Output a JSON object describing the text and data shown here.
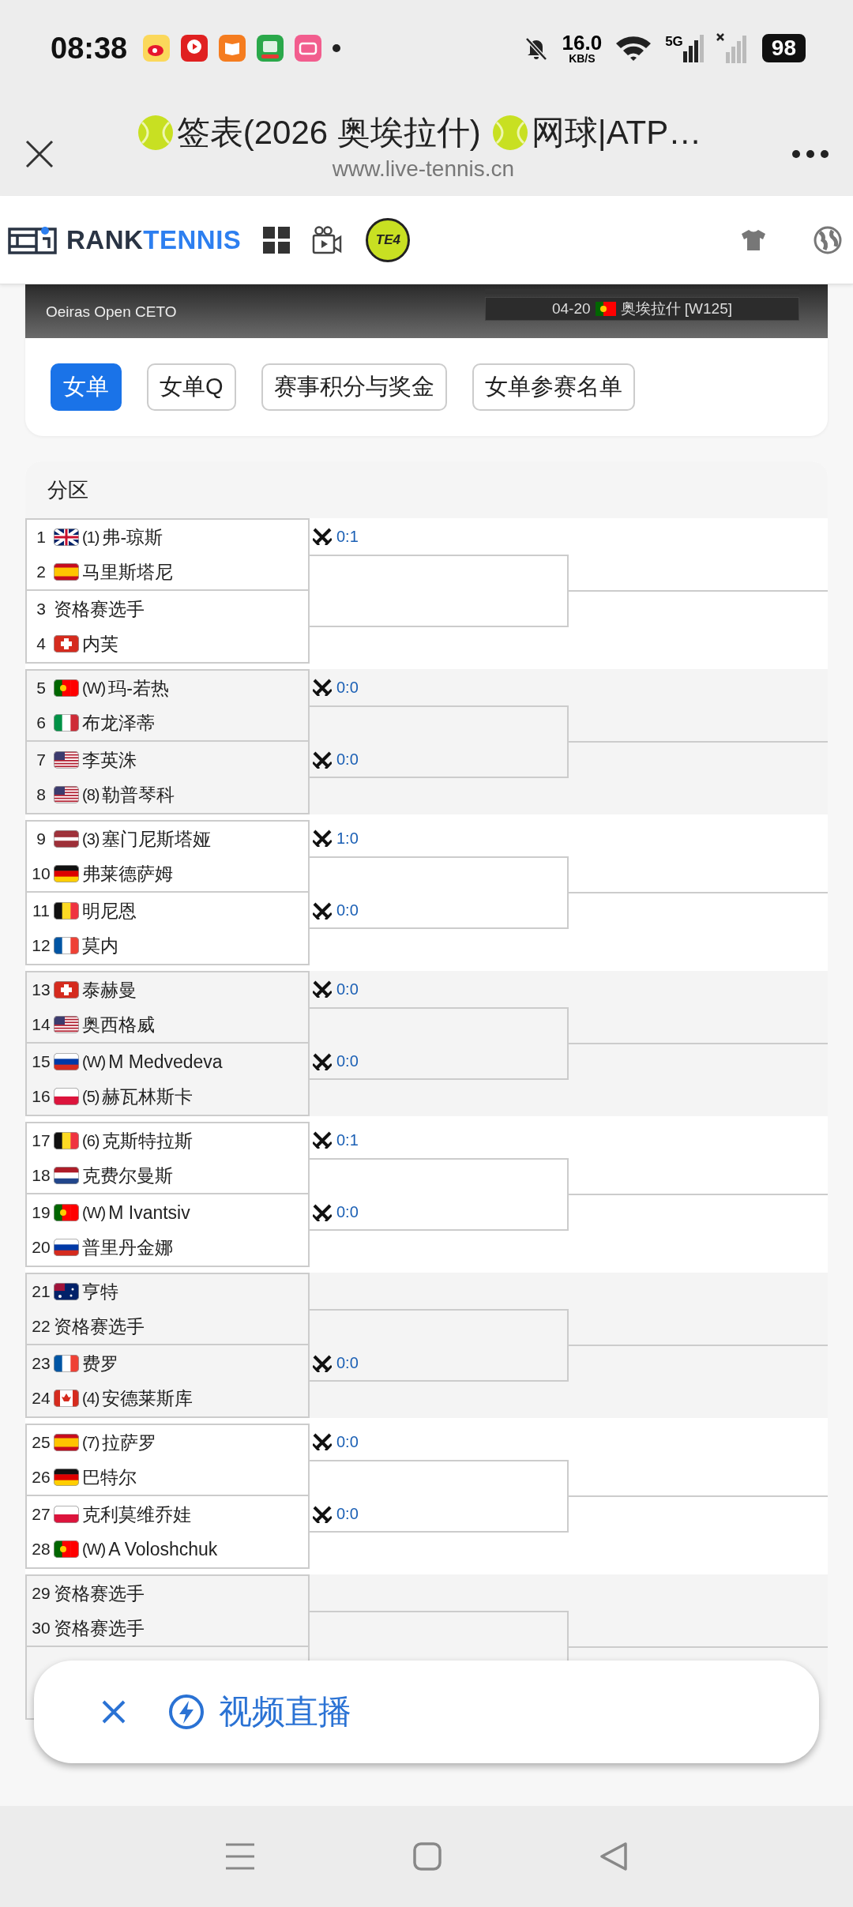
{
  "status_bar": {
    "time": "08:38",
    "speed_value": "16.0",
    "speed_unit": "KB/S",
    "network": "5G",
    "battery": "98"
  },
  "browser": {
    "title_parts": [
      "签表(2026 奥埃拉什)",
      "网球|ATP…"
    ],
    "url": "www.live-tennis.cn"
  },
  "site_header": {
    "logo_lead": "RANK",
    "logo_tail": "TENNIS",
    "badge": "TE4"
  },
  "banner": {
    "tournament": "Oeiras Open CETO",
    "date": "04-20",
    "location": "奥埃拉什 [W125]"
  },
  "tabs": [
    {
      "label": "女单",
      "selected": true
    },
    {
      "label": "女单Q",
      "selected": false
    },
    {
      "label": "赛事积分与奖金",
      "selected": false
    },
    {
      "label": "女单参赛名单",
      "selected": false
    }
  ],
  "draw": {
    "section_title": "分区",
    "groups": [
      {
        "matches": [
          {
            "score": "0:1",
            "players": [
              {
                "number": "1",
                "flag": {
                  "kind": "gb"
                },
                "seed": "(1)",
                "name": "弗-琼斯"
              },
              {
                "number": "2",
                "flag": {
                  "kind": "es"
                },
                "name": "马里斯塔尼"
              }
            ]
          },
          {
            "players": [
              {
                "number": "3",
                "name": "资格赛选手"
              },
              {
                "number": "4",
                "flag": {
                  "kind": "ch"
                },
                "name": "内芙"
              }
            ]
          }
        ]
      },
      {
        "matches": [
          {
            "score": "0:0",
            "players": [
              {
                "number": "5",
                "flag": {
                  "kind": "pt"
                },
                "seed": "(W)",
                "name": "玛-若热"
              },
              {
                "number": "6",
                "flag": {
                  "kind": "it"
                },
                "name": "布龙泽蒂"
              }
            ]
          },
          {
            "score": "0:0",
            "players": [
              {
                "number": "7",
                "flag": {
                  "kind": "us"
                },
                "name": "李英洙"
              },
              {
                "number": "8",
                "flag": {
                  "kind": "us"
                },
                "seed": "(8)",
                "name": "勒普琴科"
              }
            ]
          }
        ]
      },
      {
        "matches": [
          {
            "score": "1:0",
            "players": [
              {
                "number": "9",
                "flag": {
                  "kind": "lv"
                },
                "seed": "(3)",
                "name": "塞门尼斯塔娅"
              },
              {
                "number": "10",
                "flag": {
                  "kind": "de"
                },
                "name": "弗莱德萨姆"
              }
            ]
          },
          {
            "score": "0:0",
            "players": [
              {
                "number": "11",
                "flag": {
                  "kind": "be"
                },
                "name": "明尼恩"
              },
              {
                "number": "12",
                "flag": {
                  "kind": "fr"
                },
                "name": "莫内"
              }
            ]
          }
        ]
      },
      {
        "matches": [
          {
            "score": "0:0",
            "players": [
              {
                "number": "13",
                "flag": {
                  "kind": "ch"
                },
                "name": "泰赫曼"
              },
              {
                "number": "14",
                "flag": {
                  "kind": "us"
                },
                "name": "奥西格威"
              }
            ]
          },
          {
            "score": "0:0",
            "players": [
              {
                "number": "15",
                "flag": {
                  "kind": "ru"
                },
                "seed": "(W)",
                "name": "M Medvedeva"
              },
              {
                "number": "16",
                "flag": {
                  "kind": "pl"
                },
                "seed": "(5)",
                "name": "赫瓦林斯卡"
              }
            ]
          }
        ]
      },
      {
        "matches": [
          {
            "score": "0:1",
            "players": [
              {
                "number": "17",
                "flag": {
                  "kind": "be"
                },
                "seed": "(6)",
                "name": "克斯特拉斯"
              },
              {
                "number": "18",
                "flag": {
                  "kind": "nl"
                },
                "name": "克费尔曼斯"
              }
            ]
          },
          {
            "score": "0:0",
            "players": [
              {
                "number": "19",
                "flag": {
                  "kind": "pt"
                },
                "seed": "(W)",
                "name": "M Ivantsiv"
              },
              {
                "number": "20",
                "flag": {
                  "kind": "ru"
                },
                "name": "普里丹金娜"
              }
            ]
          }
        ]
      },
      {
        "matches": [
          {
            "players": [
              {
                "number": "21",
                "flag": {
                  "kind": "au"
                },
                "name": "亨特"
              },
              {
                "number": "22",
                "name": "资格赛选手"
              }
            ]
          },
          {
            "score": "0:0",
            "players": [
              {
                "number": "23",
                "flag": {
                  "kind": "fr"
                },
                "name": "费罗"
              },
              {
                "number": "24",
                "flag": {
                  "kind": "ca"
                },
                "seed": "(4)",
                "name": "安德莱斯库"
              }
            ]
          }
        ]
      },
      {
        "matches": [
          {
            "score": "0:0",
            "players": [
              {
                "number": "25",
                "flag": {
                  "kind": "es"
                },
                "seed": "(7)",
                "name": "拉萨罗"
              },
              {
                "number": "26",
                "flag": {
                  "kind": "de"
                },
                "name": "巴特尔"
              }
            ]
          },
          {
            "score": "0:0",
            "players": [
              {
                "number": "27",
                "flag": {
                  "kind": "pl"
                },
                "name": "克利莫维乔娃"
              },
              {
                "number": "28",
                "flag": {
                  "kind": "pt"
                },
                "seed": "(W)",
                "name": "A Voloshchuk"
              }
            ]
          }
        ]
      },
      {
        "matches": [
          {
            "players": [
              {
                "number": "29",
                "name": "资格赛选手"
              },
              {
                "number": "30",
                "name": "资格赛选手"
              }
            ]
          }
        ]
      }
    ]
  },
  "popup": {
    "label": "视频直播"
  }
}
